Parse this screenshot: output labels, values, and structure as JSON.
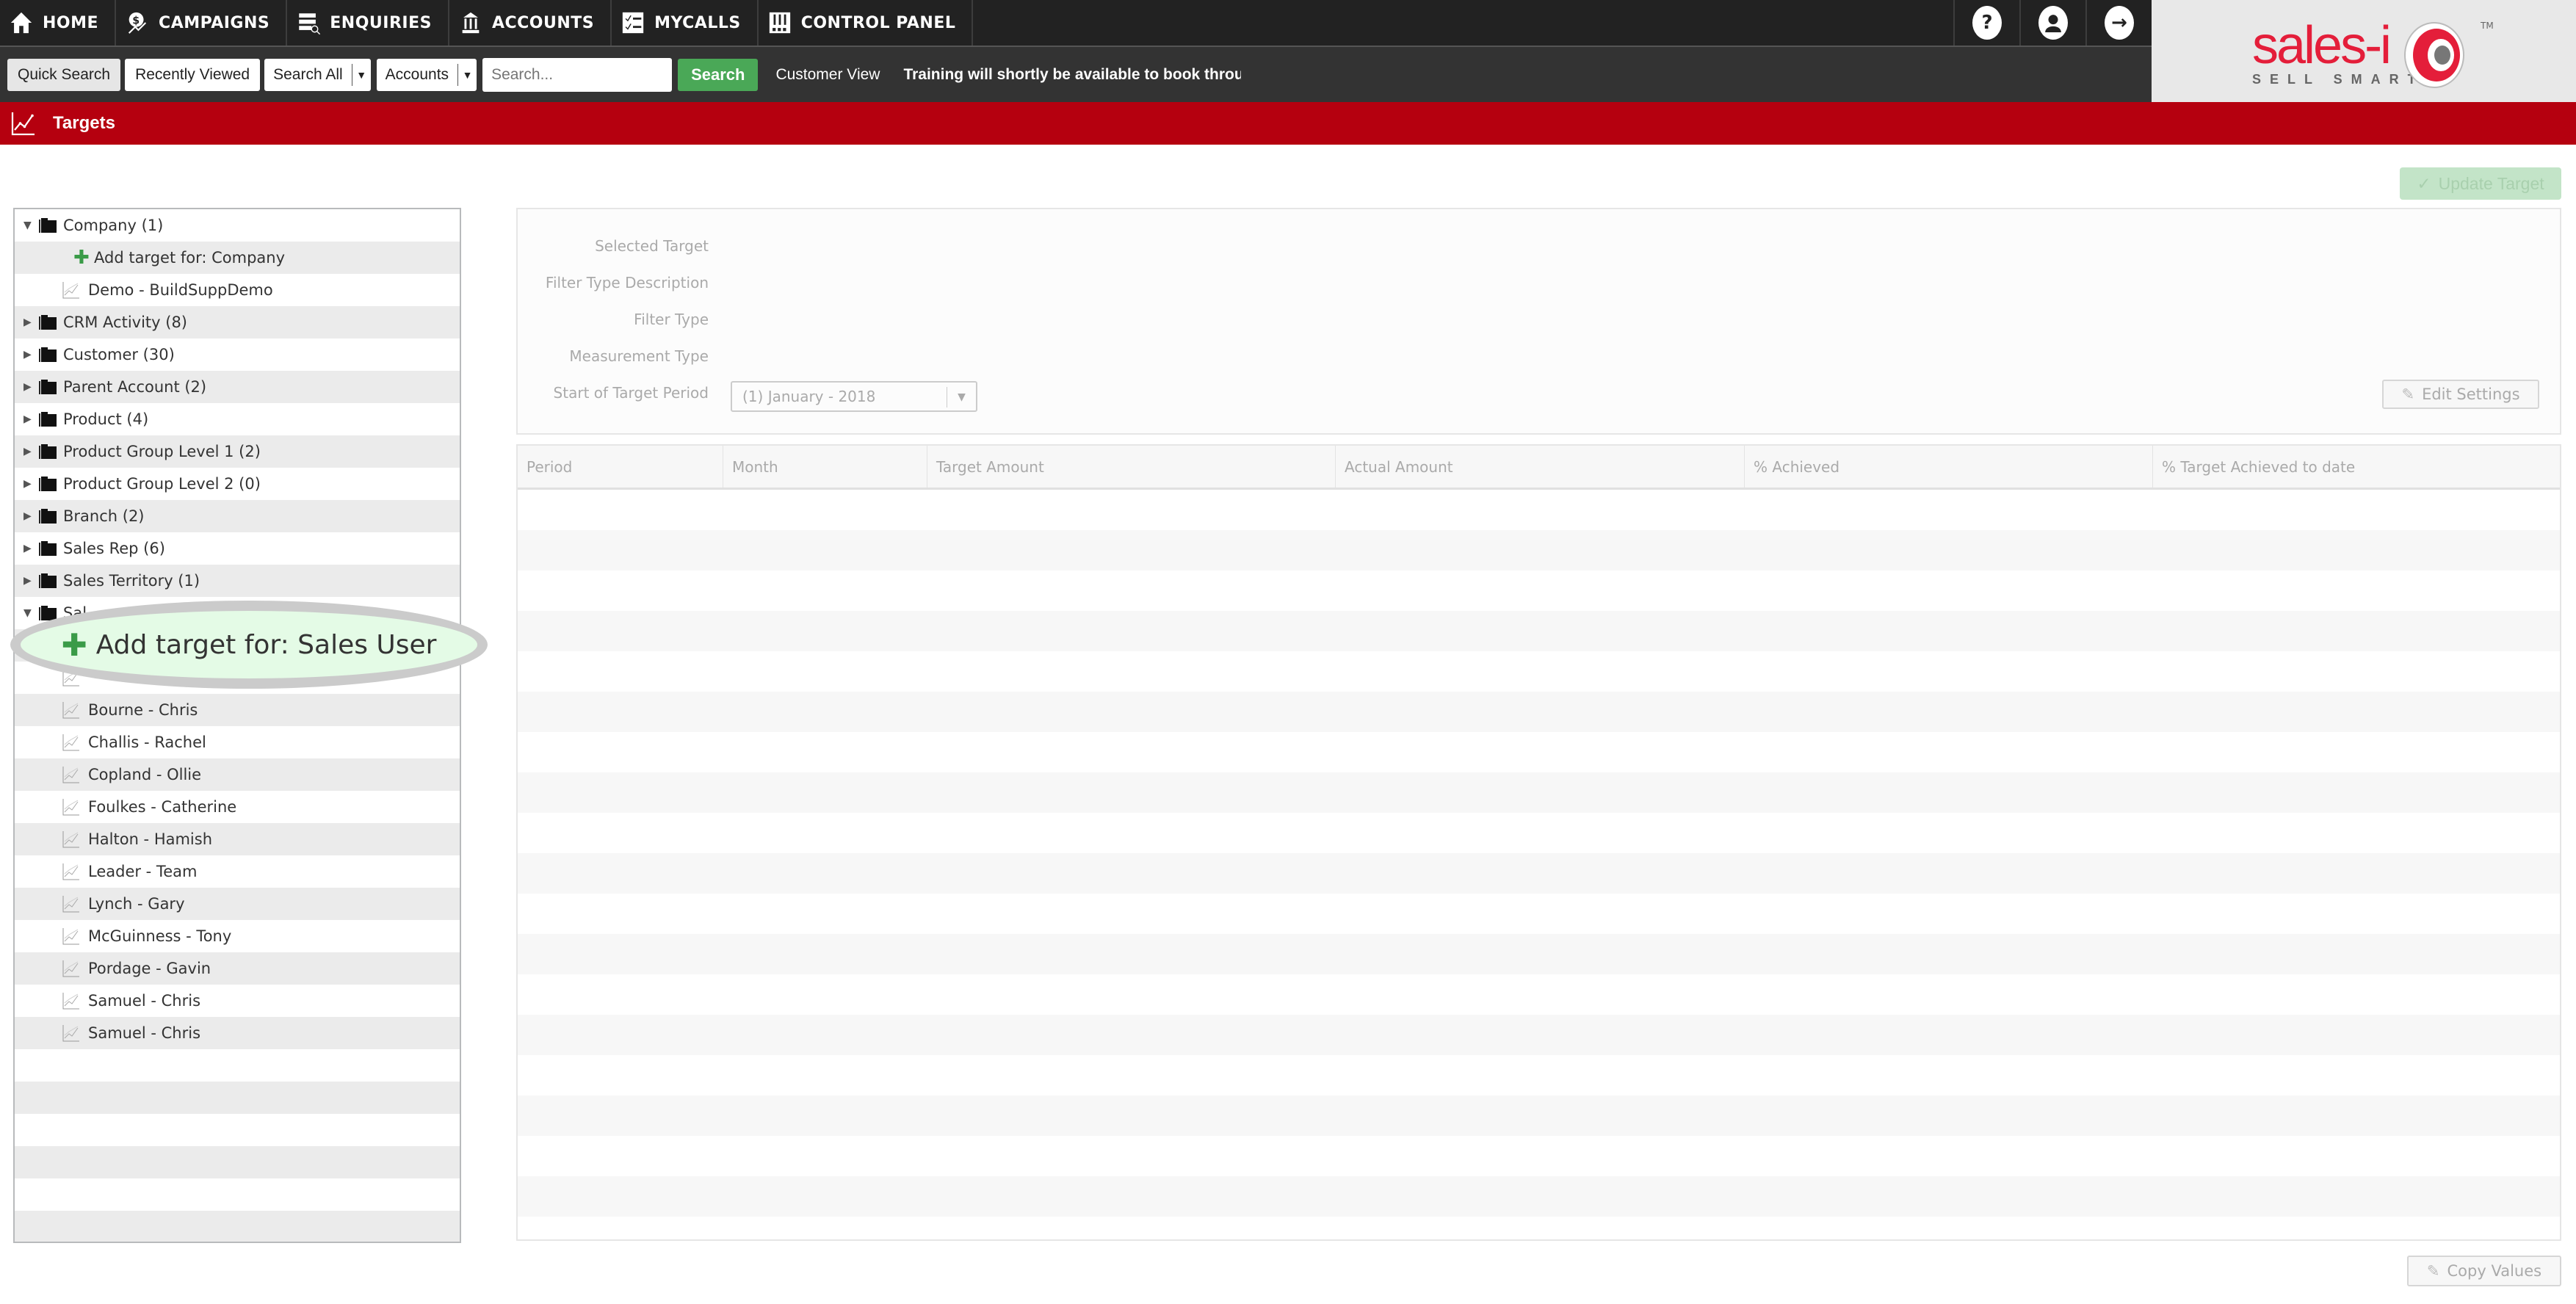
{
  "nav": {
    "items": [
      {
        "label": "HOME",
        "icon": "home-icon"
      },
      {
        "label": "CAMPAIGNS",
        "icon": "campaigns-icon"
      },
      {
        "label": "ENQUIRIES",
        "icon": "enquiries-icon"
      },
      {
        "label": "ACCOUNTS",
        "icon": "accounts-icon"
      },
      {
        "label": "MYCALLS",
        "icon": "mycalls-icon"
      },
      {
        "label": "CONTROL PANEL",
        "icon": "control-panel-icon"
      }
    ],
    "right_buttons": [
      {
        "glyph": "?",
        "icon": "help-icon"
      },
      {
        "glyph": "👤",
        "icon": "user-icon"
      },
      {
        "glyph": "→",
        "icon": "logout-icon"
      }
    ]
  },
  "searchbar": {
    "quick_search": "Quick Search",
    "recently_viewed": "Recently Viewed",
    "scope_select": "Search All",
    "type_select": "Accounts",
    "search_placeholder": "Search...",
    "search_button": "Search",
    "customer_view": "Customer View",
    "ticker": "Training will shortly be available to book throu"
  },
  "logo": {
    "word": "sales-i",
    "tagline": "SELL SMART",
    "tm": "TM",
    "brand_color": "#e41e3a"
  },
  "page": {
    "title": "Targets",
    "update_button": "Update Target",
    "edit_button": "Edit Settings",
    "copy_button": "Copy Values"
  },
  "tree": {
    "rows": [
      {
        "type": "folder",
        "expanded": true,
        "label": "Company (1)"
      },
      {
        "type": "add",
        "label": "Add target for: Company"
      },
      {
        "type": "target",
        "label": "Demo - BuildSuppDemo"
      },
      {
        "type": "folder",
        "expanded": false,
        "label": "CRM Activity (8)"
      },
      {
        "type": "folder",
        "expanded": false,
        "label": "Customer (30)"
      },
      {
        "type": "folder",
        "expanded": false,
        "label": "Parent Account (2)"
      },
      {
        "type": "folder",
        "expanded": false,
        "label": "Product (4)"
      },
      {
        "type": "folder",
        "expanded": false,
        "label": "Product Group Level 1 (2)"
      },
      {
        "type": "folder",
        "expanded": false,
        "label": "Product Group Level 2 (0)"
      },
      {
        "type": "folder",
        "expanded": false,
        "label": "Branch (2)"
      },
      {
        "type": "folder",
        "expanded": false,
        "label": "Sales Rep (6)"
      },
      {
        "type": "folder",
        "expanded": false,
        "label": "Sales Territory (1)"
      },
      {
        "type": "folder",
        "expanded": true,
        "label": "Sal..."
      },
      {
        "type": "add",
        "label": "Add target for: Sales User"
      },
      {
        "type": "target",
        "label": ""
      },
      {
        "type": "target",
        "label": "Bourne - Chris"
      },
      {
        "type": "target",
        "label": "Challis - Rachel"
      },
      {
        "type": "target",
        "label": "Copland - Ollie"
      },
      {
        "type": "target",
        "label": "Foulkes - Catherine"
      },
      {
        "type": "target",
        "label": "Halton - Hamish"
      },
      {
        "type": "target",
        "label": "Leader - Team"
      },
      {
        "type": "target",
        "label": "Lynch - Gary"
      },
      {
        "type": "target",
        "label": "McGuinness - Tony"
      },
      {
        "type": "target",
        "label": "Pordage - Gavin"
      },
      {
        "type": "target",
        "label": "Samuel - Chris"
      },
      {
        "type": "target",
        "label": "Samuel - Chris"
      }
    ],
    "highlight_label": "Add target for: Sales User"
  },
  "form": {
    "labels": [
      "Selected Target",
      "Filter Type Description",
      "Filter Type",
      "Measurement Type",
      "Start of Target Period"
    ],
    "period_value": "(1) January - 2018"
  },
  "table": {
    "columns": [
      "Period",
      "Month",
      "Target Amount",
      "Actual Amount",
      "% Achieved",
      "% Target Achieved to date"
    ],
    "rows": []
  }
}
